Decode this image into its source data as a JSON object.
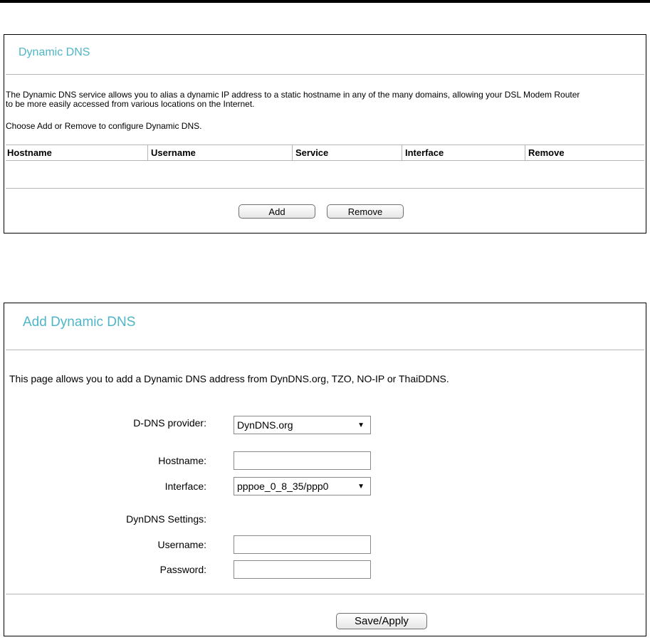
{
  "dynamic_dns": {
    "title": "Dynamic DNS",
    "description_line1": "The Dynamic DNS service allows you to alias a dynamic IP address to a static hostname in any of the many domains, allowing your DSL Modem Router",
    "description_line2": "to be more easily accessed from various locations on the Internet.",
    "instruction": "Choose Add or Remove to configure Dynamic DNS.",
    "table": {
      "columns": [
        "Hostname",
        "Username",
        "Service",
        "Interface",
        "Remove"
      ],
      "rows": []
    },
    "add_label": "Add",
    "remove_label": "Remove"
  },
  "add_dynamic_dns": {
    "title": "Add Dynamic DNS",
    "description": "This page allows you to add a Dynamic DNS address from DynDNS.org, TZO, NO-IP or ThaiDDNS.",
    "provider_label": "D-DNS provider:",
    "provider_value": "DynDNS.org",
    "hostname_label": "Hostname:",
    "hostname_value": "",
    "interface_label": "Interface:",
    "interface_value": "pppoe_0_8_35/ppp0",
    "settings_label": "DynDNS Settings:",
    "username_label": "Username:",
    "username_value": "",
    "password_label": "Password:",
    "password_value": "",
    "save_label": "Save/Apply"
  }
}
